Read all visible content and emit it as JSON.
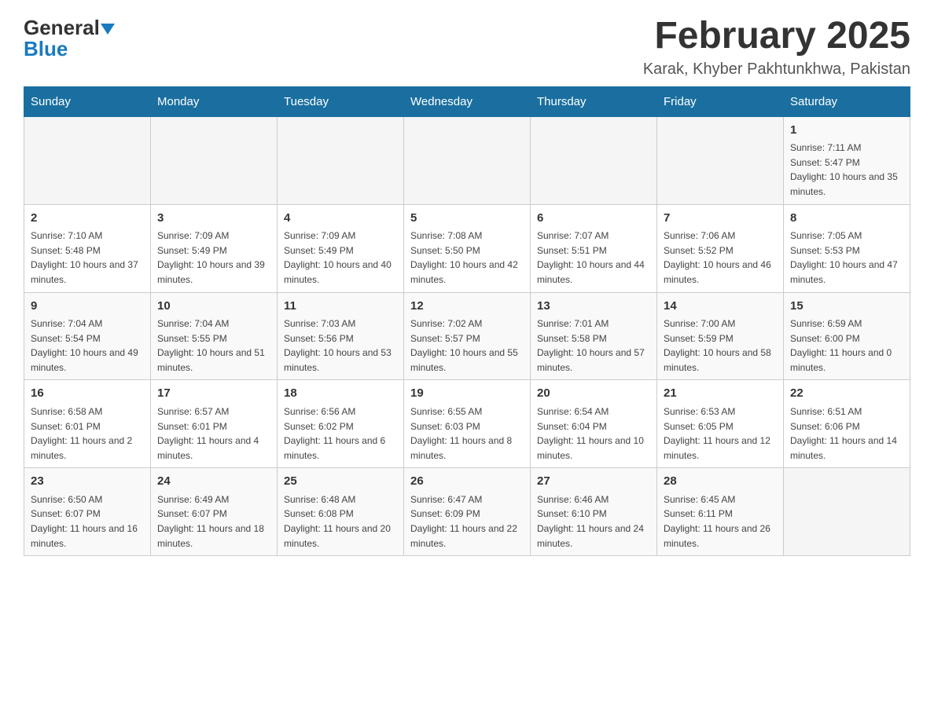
{
  "header": {
    "logo_general": "General",
    "logo_blue": "Blue",
    "title": "February 2025",
    "subtitle": "Karak, Khyber Pakhtunkhwa, Pakistan"
  },
  "weekdays": [
    "Sunday",
    "Monday",
    "Tuesday",
    "Wednesday",
    "Thursday",
    "Friday",
    "Saturday"
  ],
  "weeks": [
    [
      {
        "day": "",
        "info": ""
      },
      {
        "day": "",
        "info": ""
      },
      {
        "day": "",
        "info": ""
      },
      {
        "day": "",
        "info": ""
      },
      {
        "day": "",
        "info": ""
      },
      {
        "day": "",
        "info": ""
      },
      {
        "day": "1",
        "info": "Sunrise: 7:11 AM\nSunset: 5:47 PM\nDaylight: 10 hours and 35 minutes."
      }
    ],
    [
      {
        "day": "2",
        "info": "Sunrise: 7:10 AM\nSunset: 5:48 PM\nDaylight: 10 hours and 37 minutes."
      },
      {
        "day": "3",
        "info": "Sunrise: 7:09 AM\nSunset: 5:49 PM\nDaylight: 10 hours and 39 minutes."
      },
      {
        "day": "4",
        "info": "Sunrise: 7:09 AM\nSunset: 5:49 PM\nDaylight: 10 hours and 40 minutes."
      },
      {
        "day": "5",
        "info": "Sunrise: 7:08 AM\nSunset: 5:50 PM\nDaylight: 10 hours and 42 minutes."
      },
      {
        "day": "6",
        "info": "Sunrise: 7:07 AM\nSunset: 5:51 PM\nDaylight: 10 hours and 44 minutes."
      },
      {
        "day": "7",
        "info": "Sunrise: 7:06 AM\nSunset: 5:52 PM\nDaylight: 10 hours and 46 minutes."
      },
      {
        "day": "8",
        "info": "Sunrise: 7:05 AM\nSunset: 5:53 PM\nDaylight: 10 hours and 47 minutes."
      }
    ],
    [
      {
        "day": "9",
        "info": "Sunrise: 7:04 AM\nSunset: 5:54 PM\nDaylight: 10 hours and 49 minutes."
      },
      {
        "day": "10",
        "info": "Sunrise: 7:04 AM\nSunset: 5:55 PM\nDaylight: 10 hours and 51 minutes."
      },
      {
        "day": "11",
        "info": "Sunrise: 7:03 AM\nSunset: 5:56 PM\nDaylight: 10 hours and 53 minutes."
      },
      {
        "day": "12",
        "info": "Sunrise: 7:02 AM\nSunset: 5:57 PM\nDaylight: 10 hours and 55 minutes."
      },
      {
        "day": "13",
        "info": "Sunrise: 7:01 AM\nSunset: 5:58 PM\nDaylight: 10 hours and 57 minutes."
      },
      {
        "day": "14",
        "info": "Sunrise: 7:00 AM\nSunset: 5:59 PM\nDaylight: 10 hours and 58 minutes."
      },
      {
        "day": "15",
        "info": "Sunrise: 6:59 AM\nSunset: 6:00 PM\nDaylight: 11 hours and 0 minutes."
      }
    ],
    [
      {
        "day": "16",
        "info": "Sunrise: 6:58 AM\nSunset: 6:01 PM\nDaylight: 11 hours and 2 minutes."
      },
      {
        "day": "17",
        "info": "Sunrise: 6:57 AM\nSunset: 6:01 PM\nDaylight: 11 hours and 4 minutes."
      },
      {
        "day": "18",
        "info": "Sunrise: 6:56 AM\nSunset: 6:02 PM\nDaylight: 11 hours and 6 minutes."
      },
      {
        "day": "19",
        "info": "Sunrise: 6:55 AM\nSunset: 6:03 PM\nDaylight: 11 hours and 8 minutes."
      },
      {
        "day": "20",
        "info": "Sunrise: 6:54 AM\nSunset: 6:04 PM\nDaylight: 11 hours and 10 minutes."
      },
      {
        "day": "21",
        "info": "Sunrise: 6:53 AM\nSunset: 6:05 PM\nDaylight: 11 hours and 12 minutes."
      },
      {
        "day": "22",
        "info": "Sunrise: 6:51 AM\nSunset: 6:06 PM\nDaylight: 11 hours and 14 minutes."
      }
    ],
    [
      {
        "day": "23",
        "info": "Sunrise: 6:50 AM\nSunset: 6:07 PM\nDaylight: 11 hours and 16 minutes."
      },
      {
        "day": "24",
        "info": "Sunrise: 6:49 AM\nSunset: 6:07 PM\nDaylight: 11 hours and 18 minutes."
      },
      {
        "day": "25",
        "info": "Sunrise: 6:48 AM\nSunset: 6:08 PM\nDaylight: 11 hours and 20 minutes."
      },
      {
        "day": "26",
        "info": "Sunrise: 6:47 AM\nSunset: 6:09 PM\nDaylight: 11 hours and 22 minutes."
      },
      {
        "day": "27",
        "info": "Sunrise: 6:46 AM\nSunset: 6:10 PM\nDaylight: 11 hours and 24 minutes."
      },
      {
        "day": "28",
        "info": "Sunrise: 6:45 AM\nSunset: 6:11 PM\nDaylight: 11 hours and 26 minutes."
      },
      {
        "day": "",
        "info": ""
      }
    ]
  ]
}
